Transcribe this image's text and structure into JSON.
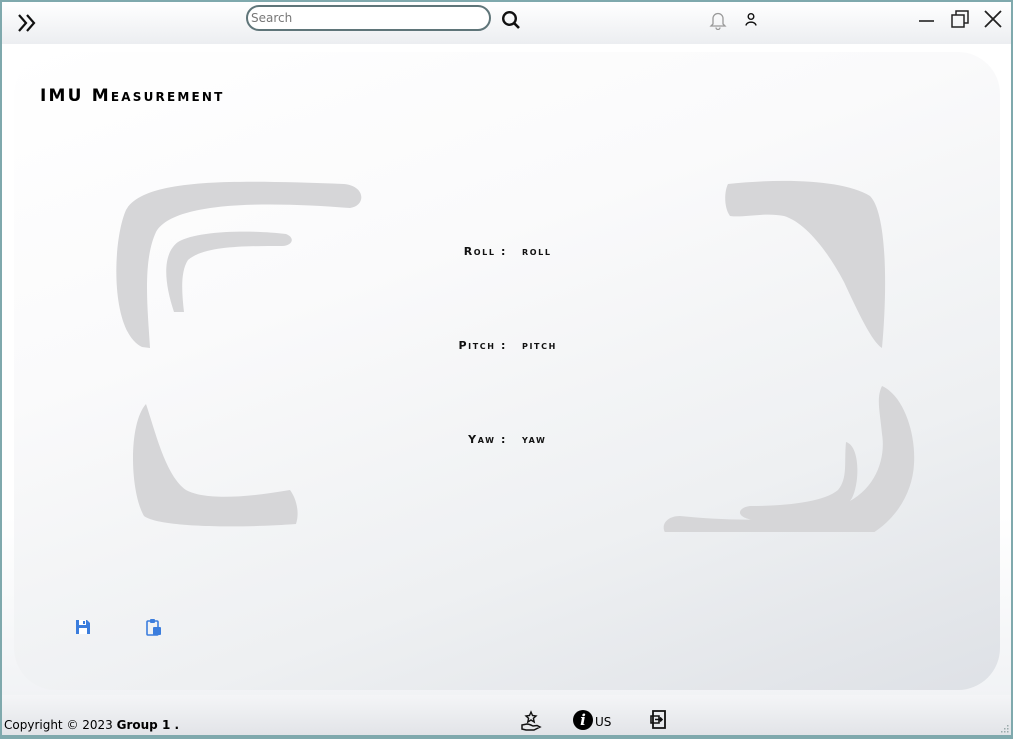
{
  "header": {
    "search": {
      "placeholder": "Search",
      "value": ""
    },
    "icons": [
      "menu-expand-icon",
      "search-icon",
      "bell-icon",
      "user-icon",
      "minimize-icon",
      "maximize-icon",
      "close-icon"
    ]
  },
  "main": {
    "title": "IMU Measurement",
    "measurements": [
      {
        "label": "Roll :",
        "value": "roll"
      },
      {
        "label": "Pitch :",
        "value": "pitch"
      },
      {
        "label": "Yaw :",
        "value": "yaw"
      }
    ],
    "actions": [
      "save-icon",
      "clipboard-icon"
    ]
  },
  "footer": {
    "copyright_prefix": "Copyright © 2023 ",
    "copyright_group": "Group 1 .",
    "about_label": "US",
    "about_icon": "info"
  },
  "colors": {
    "accent_icon": "#3b7ddd",
    "search_border": "#5f7579",
    "frame_gray": "#d6d6d8"
  }
}
